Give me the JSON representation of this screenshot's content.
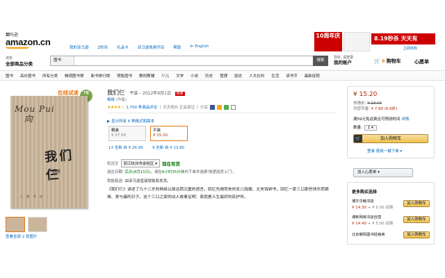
{
  "header": {
    "logo_cn": "亚马逊",
    "logo_en": "amazon.cn",
    "anniversary": "10",
    "top_nav": [
      "我的亚马逊",
      "Z秒杀",
      "礼品卡",
      "亚马逊免费开店",
      "帮助",
      "In English"
    ],
    "promo_left": "10周年庆",
    "promo_right": "8.19秒杀 天天有",
    "promo_sub": "立即抢购",
    "shop_by_small": "浏览",
    "shop_by_big": "全部商品分类",
    "search_category": "图书",
    "search_value": "",
    "search_button": "搜索",
    "account_small": "您好, 请登录",
    "account_big": "我的账户",
    "cart_count": "0",
    "cart_label": "购物车",
    "wishlist_label": "心愿单"
  },
  "category_nav": [
    "图书",
    "高价图书",
    "所有分类",
    "畅销图书榜",
    "新书排行榜",
    "预售图书",
    "教材教辅",
    "少儿",
    "文学",
    "小说",
    "历史",
    "管理",
    "励志",
    "人文社科",
    "生活",
    "读书节",
    "最新促销"
  ],
  "media": {
    "trial_text": "在线试读",
    "badge_text": "7折",
    "cover_handwriting_1": "Mou Pui",
    "cover_handwriting_2": "向",
    "cover_title": "我们仨",
    "cover_author": "杨绛",
    "cover_footer": "三 联 书 店",
    "view_all": "查看全部 2 张图片"
  },
  "product": {
    "title": "我们仨",
    "format_info": "平装 – 2012年9月1日",
    "hot_badge": "热卖",
    "author": "杨绛",
    "author_role": "(作者)",
    "stars": "★★★★☆",
    "reviews": "1,700 条商品评论",
    "qa": "天天低价·正品保证",
    "share": "分享",
    "format_toggle": "▶ 显示所有 6 种格式和版本",
    "formats": [
      {
        "name": "精装",
        "price": "¥ 27.50"
      },
      {
        "name": "平装",
        "price": "¥ 15.20"
      }
    ],
    "format_used": [
      "13 全新 自 ¥ 26.90",
      "9 全新 自 ¥ 13.80"
    ],
    "deliver_label": "配送至",
    "deliver_location": "浙江杭州市余杭区 ▾",
    "in_stock": "现在有货",
    "delivery_label": "送达日期:",
    "delivery_date": "后天(8月15日)",
    "delivery_rest": "，请在",
    "delivery_time": "6小时35分钟",
    "delivery_tail": "内下单并选择'快递送货上门'。",
    "seller_label": "销售配送:",
    "seller_text": "由亚马逊直接销售和发货。",
    "description": "《我们仨》讲述了九十二岁的杨绛以简洁而沉重的语言，回忆先她而去的女儿钱瑗、丈夫钱钟书，回忆一家三口那些快乐而艰难、爱与痛的日子。这个三口之家的动人故事证明：家庭是人生最好的庇护所。"
  },
  "buybox": {
    "price": "¥ 15.20",
    "list_price_label": "市场价:",
    "list_price": "¥ 23.00",
    "savings_label": "为您节省:",
    "savings": "¥ 7.80 (6.6折)",
    "shipping_info": "满59元免运费且可预测时间",
    "detail_link": "详情",
    "qty_label": "数量:",
    "qty_value": "1 ▾",
    "add_to_cart": "加入购物车",
    "one_click": "登录  使用一键下单 ▾",
    "wishlist_button": "加入心愿单 ▾"
  },
  "more_buying": {
    "heading": "更多购买选择",
    "sellers": [
      {
        "name": "博华华翰书店",
        "price": "¥ 14.30",
        "shipping": "+ ¥ 5.00 运费",
        "btn": "加入购物车"
      },
      {
        "name": "博新网络书店自营",
        "price": "¥ 14.40",
        "shipping": "+ ¥ 5.00 运费",
        "btn": "加入购物车"
      },
      {
        "name": "北京朝阳图书经销商",
        "price": "",
        "shipping": "",
        "btn": "加入购物车"
      }
    ]
  },
  "colors": {
    "price_red": "#b12704",
    "link_blue": "#0066c0",
    "stock_green": "#007600",
    "button_yellow": "#f0c14b",
    "accent_orange": "#e47911"
  }
}
